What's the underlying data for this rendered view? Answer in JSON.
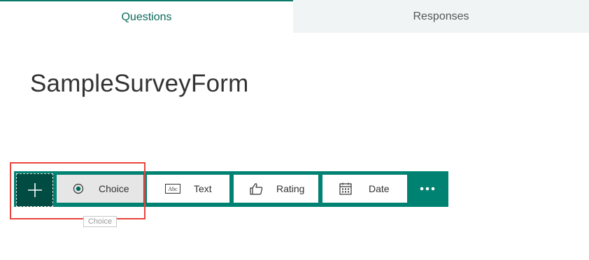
{
  "tabs": {
    "questions": "Questions",
    "responses": "Responses"
  },
  "form": {
    "title": "SampleSurveyForm"
  },
  "toolbar": {
    "add_icon": "plus-icon",
    "buttons": [
      {
        "label": "Choice",
        "icon": "radio-button-icon",
        "selected": true
      },
      {
        "label": "Text",
        "icon": "text-abc-icon"
      },
      {
        "label": "Rating",
        "icon": "thumbs-up-icon"
      },
      {
        "label": "Date",
        "icon": "calendar-icon"
      }
    ],
    "more_icon": "more-ellipsis-icon"
  },
  "tooltip": {
    "text": "Choice"
  },
  "colors": {
    "accent": "#008272",
    "accent_dark": "#004b42",
    "highlight": "#e8453c"
  }
}
